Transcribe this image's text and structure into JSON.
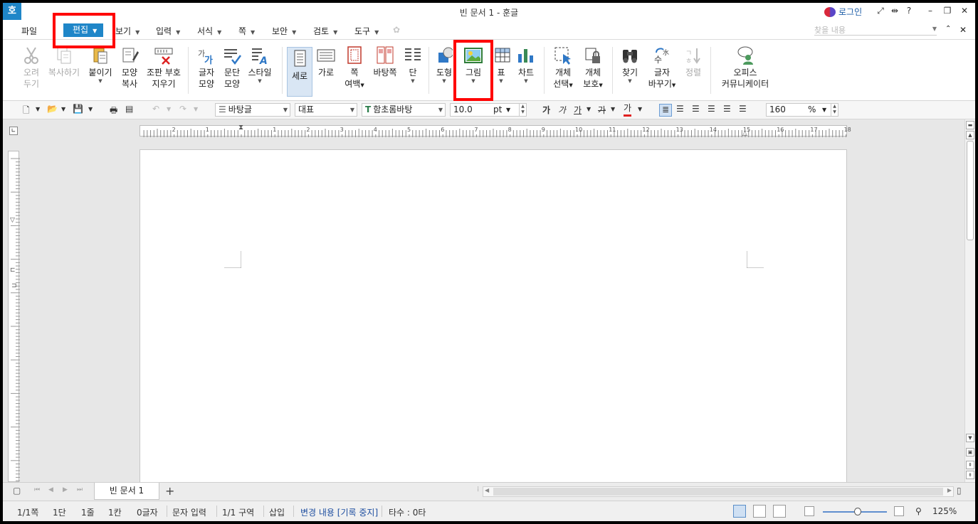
{
  "window": {
    "app_icon": "호",
    "title": "빈 문서 1 - 훈글",
    "login": "로그인",
    "controls": [
      "fullscreen-icon",
      "resize-icon",
      "help-icon",
      "minimize-icon",
      "restore-icon",
      "close-icon"
    ],
    "help": "?"
  },
  "menu": {
    "file": "파일",
    "edit": "편집",
    "items": [
      {
        "label": "보기",
        "visible": "보기"
      },
      {
        "label": "입력"
      },
      {
        "label": "서식"
      },
      {
        "label": "쪽"
      },
      {
        "label": "보안"
      },
      {
        "label": "검토"
      },
      {
        "label": "도구"
      }
    ],
    "search_placeholder": "찾을 내용"
  },
  "ribbon": {
    "cut": [
      "오려",
      "두기"
    ],
    "copy": "복사하기",
    "paste": "붙이기",
    "format_copy": [
      "모양",
      "복사"
    ],
    "clear_marks": [
      "조판 부호",
      "지우기"
    ],
    "char_shape": [
      "글자",
      "모양"
    ],
    "para_shape": [
      "문단",
      "모양"
    ],
    "style": "스타일",
    "portrait": "세로",
    "landscape": "가로",
    "page_margin": [
      "쪽",
      "여백"
    ],
    "page_bg": "바탕쪽",
    "columns": "단",
    "shape": "도형",
    "picture": "그림",
    "table": "표",
    "chart": "차트",
    "object_select": [
      "개체",
      "선택"
    ],
    "object_protect": [
      "개체",
      "보호"
    ],
    "find": "찾기",
    "replace": [
      "글자",
      "바꾸기"
    ],
    "sort": "정렬",
    "office_comm": [
      "오피스",
      "커뮤니케이터"
    ]
  },
  "toolbar": {
    "para_style": "바탕글",
    "lang": "대표",
    "font": "함초롬바탕",
    "font_size": "10.0",
    "font_unit": "pt",
    "bold_glyph": "가",
    "italic_glyph": "가",
    "underline_glyph": "가",
    "strike_glyph": "가",
    "color_glyph": "가",
    "zoom": "160",
    "zoom_unit": "%"
  },
  "ruler": {
    "h_ticks": [
      "2",
      "1",
      "1",
      "2",
      "3",
      "4",
      "5",
      "6",
      "7",
      "8",
      "9",
      "10",
      "11",
      "12",
      "13",
      "14",
      "15",
      "16",
      "17",
      "18"
    ]
  },
  "tabs": {
    "doc_tab": "빈 문서 1",
    "add": "+"
  },
  "status": {
    "page": "1/1쪽",
    "column": "1단",
    "line": "1줄",
    "col": "1칸",
    "chars": "0글자",
    "input_mode": "문자 입력",
    "section": "1/1 구역",
    "insert": "삽입",
    "track": "변경 내용 [기록 중지]",
    "typing": "타수 : 0타",
    "zoom": "125%"
  },
  "colors": {
    "accent": "#1f86c8",
    "highlight": "#ff0000"
  }
}
